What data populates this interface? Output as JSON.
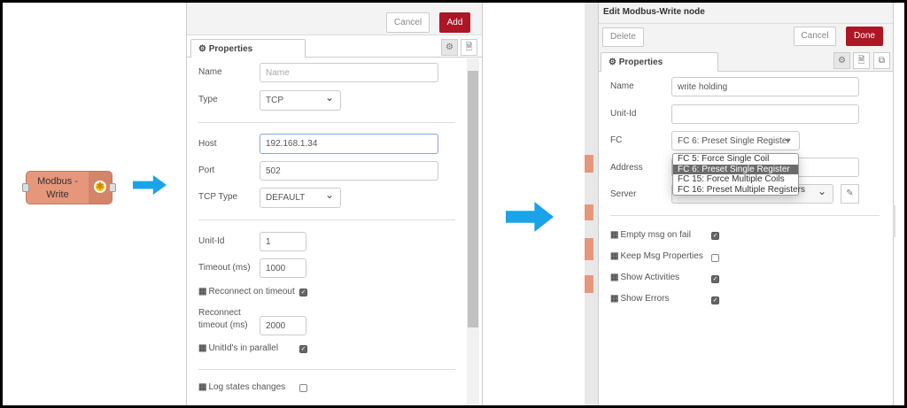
{
  "colors": {
    "node": "#e6977b",
    "arrow": "#1aa3e8",
    "primary": "#ad1625"
  },
  "node": {
    "label_line1": "Modbus -",
    "label_line2": "Write",
    "icon": "modbus-icon"
  },
  "left_dialog": {
    "cancel": "Cancel",
    "add": "Add",
    "tab": "Properties",
    "fields": {
      "name_label": "Name",
      "name_placeholder": "Name",
      "type_label": "Type",
      "type_value": "TCP",
      "host_label": "Host",
      "host_value": "192.168.1.34",
      "port_label": "Port",
      "port_value": "502",
      "tcptype_label": "TCP Type",
      "tcptype_value": "DEFAULT",
      "unitid_label": "Unit-Id",
      "unitid_value": "1",
      "timeout_label": "Timeout (ms)",
      "timeout_value": "1000",
      "reconnect_label": "Reconnect on timeout",
      "reconnect_checked": true,
      "reconnect_timeout_label1": "Reconnect",
      "reconnect_timeout_label2": "timeout (ms)",
      "reconnect_timeout_value": "2000",
      "parallel_label": "UnitId's in parallel",
      "parallel_checked": true,
      "log_label": "Log states changes",
      "log_checked": false
    }
  },
  "right_dialog": {
    "title": "Edit Modbus-Write node",
    "delete": "Delete",
    "cancel": "Cancel",
    "done": "Done",
    "tab": "Properties",
    "fields": {
      "name_label": "Name",
      "name_value": "write holding",
      "unitid_label": "Unit-Id",
      "unitid_value": "",
      "fc_label": "FC",
      "fc_value": "FC 6: Preset Single Register",
      "fc_options": [
        "FC 5: Force Single Coil",
        "FC 6: Preset Single Register",
        "FC 15: Force Multiple Coils",
        "FC 16: Preset Multiple Registers"
      ],
      "address_label": "Address",
      "server_label": "Server",
      "empty_label": "Empty msg on fail",
      "empty_checked": true,
      "keep_label": "Keep Msg Properties",
      "keep_checked": false,
      "activities_label": "Show Activities",
      "activities_checked": true,
      "errors_label": "Show Errors",
      "errors_checked": true
    }
  }
}
